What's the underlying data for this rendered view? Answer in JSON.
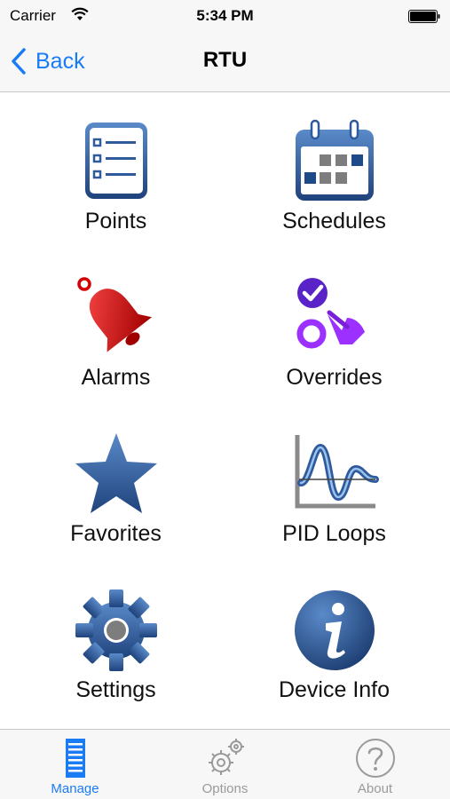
{
  "status_bar": {
    "carrier": "Carrier",
    "time": "5:34 PM"
  },
  "nav": {
    "back_label": "Back",
    "title": "RTU"
  },
  "tiles": [
    {
      "label": "Points",
      "icon": "list-icon"
    },
    {
      "label": "Schedules",
      "icon": "calendar-icon"
    },
    {
      "label": "Alarms",
      "icon": "bell-icon"
    },
    {
      "label": "Overrides",
      "icon": "override-icon"
    },
    {
      "label": "Favorites",
      "icon": "star-icon"
    },
    {
      "label": "PID Loops",
      "icon": "pid-chart-icon"
    },
    {
      "label": "Settings",
      "icon": "gear-icon"
    },
    {
      "label": "Device Info",
      "icon": "info-icon"
    }
  ],
  "tab_bar": {
    "tabs": [
      {
        "label": "Manage",
        "icon": "building-icon",
        "active": true
      },
      {
        "label": "Options",
        "icon": "gears-icon",
        "active": false
      },
      {
        "label": "About",
        "icon": "question-icon",
        "active": false
      }
    ]
  },
  "colors": {
    "accent": "#1a7cf5",
    "icon_blue": "#2f5b9c",
    "alarm_red": "#d40000",
    "override_purple": "#8a2be2"
  }
}
